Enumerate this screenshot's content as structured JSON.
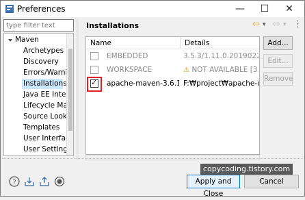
{
  "window": {
    "title": "Preferences",
    "minimize_glyph": "—",
    "maximize_glyph": "☐",
    "close_glyph": "✕"
  },
  "filter": {
    "placeholder": "type filter text",
    "value": ""
  },
  "tree": {
    "items": [
      {
        "label": "Maven"
      },
      {
        "label": "Archetypes"
      },
      {
        "label": "Discovery"
      },
      {
        "label": "Errors/Warnin"
      },
      {
        "label": "Installations"
      },
      {
        "label": "Java EE Integr"
      },
      {
        "label": "Lifecycle Mapp"
      },
      {
        "label": "Source Looku"
      },
      {
        "label": "Templates"
      },
      {
        "label": "User Interface"
      },
      {
        "label": "User Settings"
      }
    ]
  },
  "page": {
    "title": "Installations"
  },
  "nav": {
    "back_glyph": "⇦",
    "menu_glyph": "▾",
    "forward_glyph": "⇨",
    "more_glyph": "⋮"
  },
  "table": {
    "columns": [
      "Name",
      "Details"
    ],
    "rows": [
      {
        "name": "EMBEDDED",
        "details": "3.5.3/1.11.0.20190220-2",
        "checked": false,
        "muted": true
      },
      {
        "name": "WORKSPACE",
        "details": "NOT AVAILABLE [3.0,)",
        "checked": false,
        "muted": true,
        "warning": true
      },
      {
        "name": "apache-maven-3.6.1",
        "details": "F:₩project₩apache-mave",
        "checked": true,
        "muted": false
      }
    ]
  },
  "buttons": {
    "add": "Add...",
    "edit": "Edit...",
    "remove": "Remove",
    "apply_close": "Apply and Close",
    "cancel": "Cancel"
  },
  "watermark": "copycoding.tistory.com",
  "colors": {
    "selection": "#cce8ff",
    "highlight": "#e02020",
    "default_button_border": "#0078d7",
    "warning": "#d28b00"
  },
  "icons": [
    "help-icon",
    "import-icon",
    "export-icon",
    "record-icon"
  ]
}
